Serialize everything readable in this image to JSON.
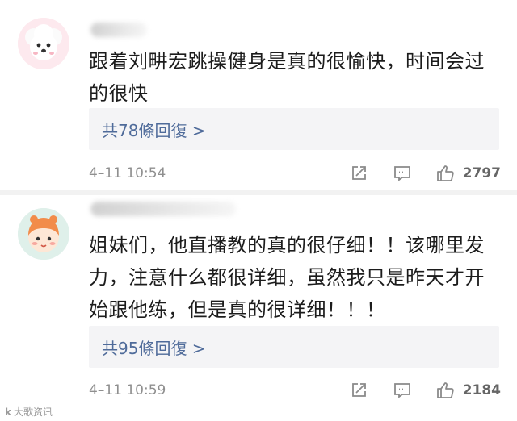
{
  "comments": [
    {
      "text": "跟着刘畊宏跳操健身是真的很愉快，时间会过的很快",
      "replies": "共78條回復 >",
      "time": "4–11 10:54",
      "likes": "2797"
    },
    {
      "text": "姐妹们，他直播教的真的很仔细！！该哪里发力，注意什么都很详细，虽然我只是昨天才开始跟他练，但是真的很详细！！！",
      "replies": "共95條回復 >",
      "time": "4–11 10:59",
      "likes": "2184"
    }
  ],
  "icons": {
    "share": "share-icon",
    "comment": "comment-icon",
    "like": "thumbs-up-icon"
  },
  "watermark": {
    "logo": "k",
    "text": "大歌资讯"
  },
  "colors": {
    "reply_link": "#4f6b9a",
    "reply_bg": "#f4f4f6",
    "meta": "#8f8f8f"
  }
}
